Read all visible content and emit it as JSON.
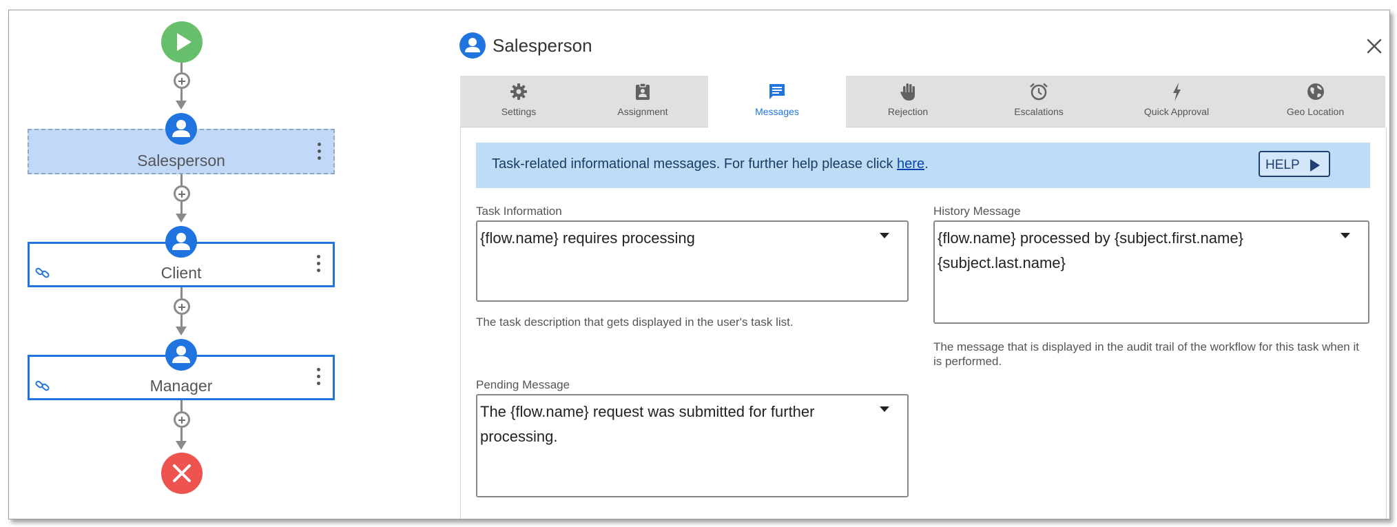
{
  "workflow": {
    "nodes": [
      {
        "label": "Salesperson",
        "state": "selected",
        "linked": false
      },
      {
        "label": "Client",
        "state": "normal",
        "linked": true
      },
      {
        "label": "Manager",
        "state": "normal",
        "linked": true
      }
    ],
    "start_icon": "play-icon",
    "end_icon": "close-icon"
  },
  "panel": {
    "title": "Salesperson",
    "title_icon": "user-icon",
    "tabs": [
      {
        "label": "Settings",
        "icon": "gear-icon",
        "active": false
      },
      {
        "label": "Assignment",
        "icon": "assignment-icon",
        "active": false
      },
      {
        "label": "Messages",
        "icon": "message-icon",
        "active": true
      },
      {
        "label": "Rejection",
        "icon": "hand-icon",
        "active": false
      },
      {
        "label": "Escalations",
        "icon": "alarm-icon",
        "active": false
      },
      {
        "label": "Quick Approval",
        "icon": "lightning-icon",
        "active": false
      },
      {
        "label": "Geo Location",
        "icon": "globe-icon",
        "active": false
      }
    ],
    "banner": {
      "text": "Task-related informational messages. For further help please click ",
      "link": "here",
      "suffix": ".",
      "help_label": "HELP"
    },
    "fields": {
      "task_information": {
        "label": "Task Information",
        "value": "{flow.name} requires processing",
        "help": "The task description that gets displayed in the user's task list."
      },
      "history_message": {
        "label": "History Message",
        "value": "{flow.name} processed by {subject.first.name} {subject.last.name}",
        "help": "The message that is displayed in the audit trail of the workflow for this task when it is performed."
      },
      "pending_message": {
        "label": "Pending Message",
        "value": "The {flow.name} request was submitted for further processing."
      }
    }
  },
  "colors": {
    "accent": "#1f74e0",
    "start": "#67bf6b",
    "end": "#ef5350",
    "banner": "#bfdcf6",
    "selected_node": "#c2d8f9"
  }
}
